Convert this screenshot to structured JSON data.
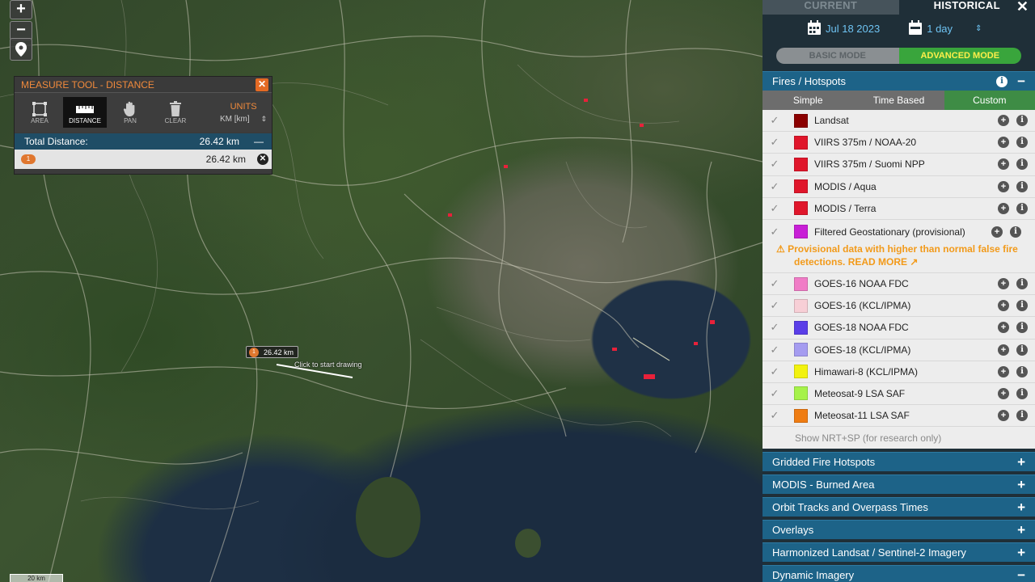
{
  "map": {
    "zoom_in": "+",
    "zoom_out": "−",
    "scale": "20 km",
    "label_distance": "26.42 km",
    "label_index": "1",
    "hint": "Click to start drawing"
  },
  "measure": {
    "title": "MEASURE TOOL - DISTANCE",
    "tools": [
      {
        "label": "AREA",
        "icon": "area-icon"
      },
      {
        "label": "DISTANCE",
        "icon": "ruler-icon"
      },
      {
        "label": "PAN",
        "icon": "hand-icon"
      },
      {
        "label": "CLEAR",
        "icon": "trash-icon"
      }
    ],
    "units_label": "UNITS",
    "units_value": "KM [km]",
    "total_label": "Total Distance:",
    "total_value": "26.42 km",
    "segment_index": "1",
    "segment_value": "26.42 km"
  },
  "panel": {
    "tab_current": "CURRENT",
    "tab_historical": "HISTORICAL",
    "date": "Jul 18 2023",
    "range": "1 day",
    "mode_basic": "BASIC MODE",
    "mode_advanced": "ADVANCED MODE",
    "fires_title": "Fires / Hotspots",
    "subtabs": [
      "Simple",
      "Time Based",
      "Custom"
    ],
    "layers": [
      {
        "name": "Landsat",
        "color": "#8b0000"
      },
      {
        "name": "VIIRS 375m / NOAA-20",
        "color": "#e0162b"
      },
      {
        "name": "VIIRS 375m / Suomi NPP",
        "color": "#e0162b"
      },
      {
        "name": "MODIS / Aqua",
        "color": "#e0162b"
      },
      {
        "name": "MODIS / Terra",
        "color": "#e0162b"
      }
    ],
    "filtered": {
      "name": "Filtered Geostationary (provisional)",
      "color": "#c81fd6",
      "warning": "Provisional data with higher than normal false fire detections.",
      "read_more": "READ MORE"
    },
    "layers2": [
      {
        "name": "GOES-16 NOAA FDC",
        "color": "#f07cc6"
      },
      {
        "name": "GOES-16 (KCL/IPMA)",
        "color": "#f7cfd6"
      },
      {
        "name": "GOES-18 NOAA FDC",
        "color": "#5a3ee8"
      },
      {
        "name": "GOES-18 (KCL/IPMA)",
        "color": "#a59cf0"
      },
      {
        "name": "Himawari-8 (KCL/IPMA)",
        "color": "#f2f20f"
      },
      {
        "name": "Meteosat-9 LSA SAF",
        "color": "#a6f24a"
      },
      {
        "name": "Meteosat-11 LSA SAF",
        "color": "#ef7c12"
      }
    ],
    "nrt_sp": "Show NRT+SP (for research only)",
    "sections": [
      {
        "title": "Gridded Fire Hotspots",
        "sign": "+"
      },
      {
        "title": "MODIS - Burned Area",
        "sign": "+"
      },
      {
        "title": "Orbit Tracks and Overpass Times",
        "sign": "+"
      },
      {
        "title": "Overlays",
        "sign": "+"
      },
      {
        "title": "Harmonized Landsat / Sentinel-2 Imagery",
        "sign": "+"
      },
      {
        "title": "Dynamic Imagery",
        "sign": "−"
      }
    ]
  }
}
